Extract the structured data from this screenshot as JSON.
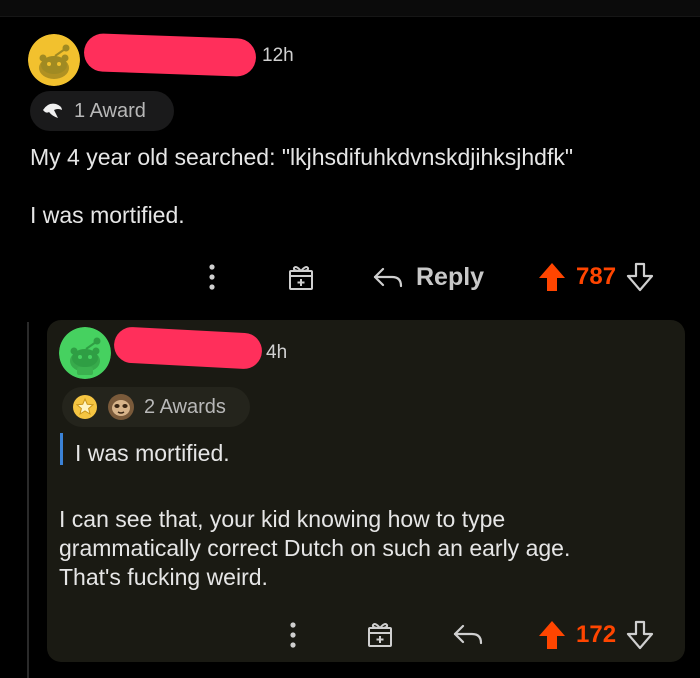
{
  "comment": {
    "time": "12h",
    "award_count_label": "1 Award",
    "body_line1": "My 4 year old searched: \"lkjhsdifuhkdvnskdjihksjhdfk\"",
    "body_line2": "I was mortified.",
    "actions": {
      "reply_label": "Reply",
      "score": "787"
    },
    "colors": {
      "upvote": "#ff4500",
      "avatar": "#f2c12e"
    },
    "icons": [
      "more-options-icon",
      "gift-award-icon",
      "reply-arrow-icon",
      "upvote-icon",
      "downvote-icon"
    ]
  },
  "reply": {
    "time": "4h",
    "award_count_label": "2 Awards",
    "quote": "I was mortified.",
    "body_line1": "I can see that, your kid knowing how to type",
    "body_line2": "grammatically correct Dutch on such an early age.",
    "body_line3": "That's fucking weird.",
    "actions": {
      "score": "172"
    },
    "colors": {
      "upvote": "#ff4500",
      "avatar": "#46d160",
      "quote_bar": "#3b82d6"
    }
  }
}
